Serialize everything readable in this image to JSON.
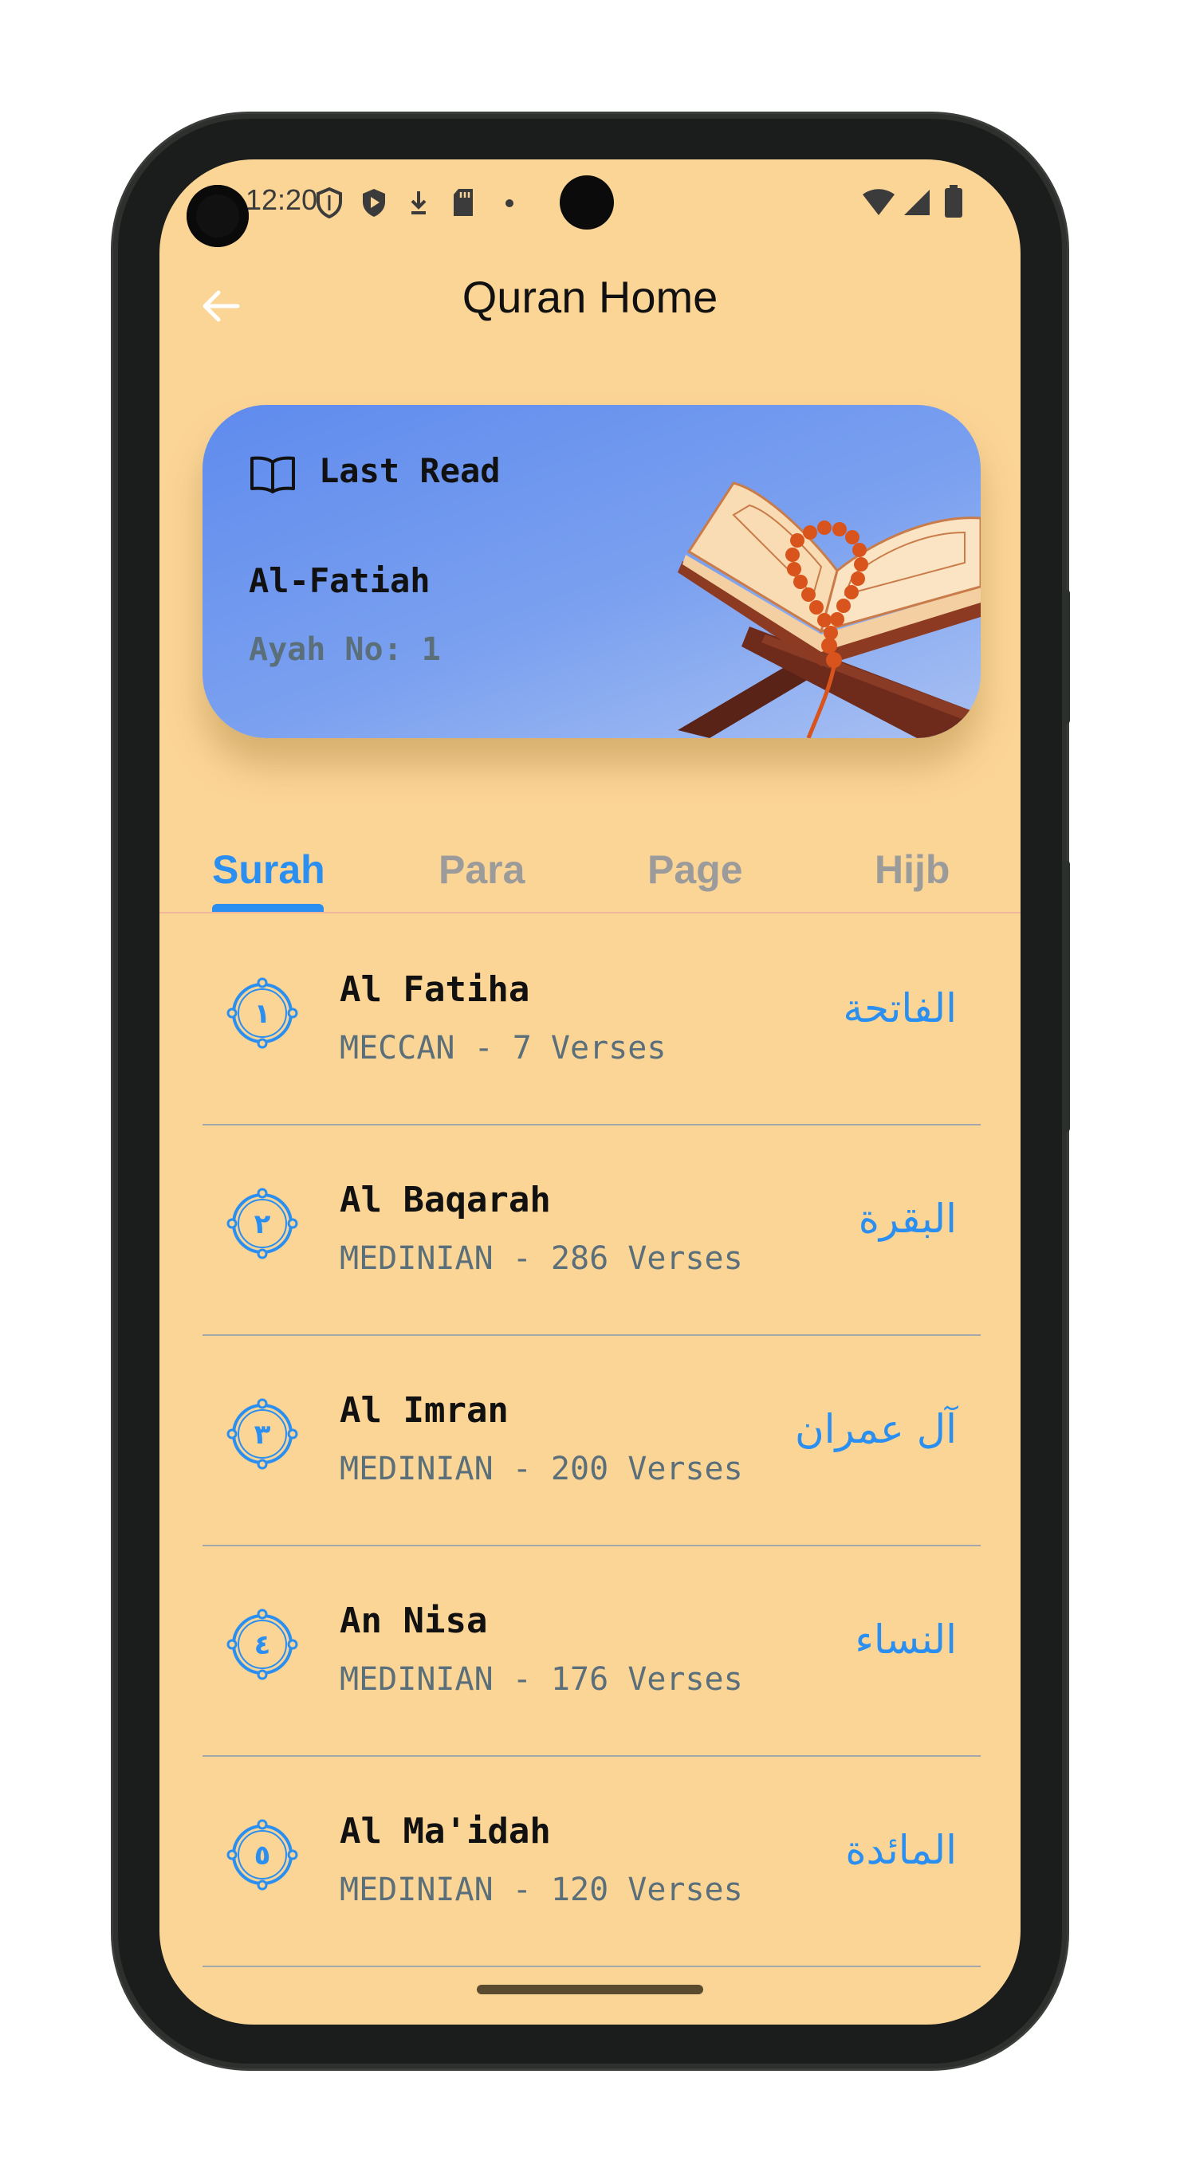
{
  "status_bar": {
    "time": "12:20",
    "left_icons": [
      "shield-outline-icon",
      "shield-play-icon",
      "download-arrow-icon",
      "sd-card-icon",
      "dot-icon"
    ],
    "right_icons": [
      "wifi-icon",
      "signal-icon",
      "battery-icon"
    ]
  },
  "app_bar": {
    "back_icon": "arrow-left-icon",
    "title": "Quran Home"
  },
  "last_read": {
    "icon": "open-book-icon",
    "label": "Last Read",
    "surah": "Al-Fatiah",
    "ayah": "Ayah No: 1",
    "image": "quran-on-stand-with-prayer-beads"
  },
  "tabs": [
    {
      "label": "Surah",
      "active": true
    },
    {
      "label": "Para",
      "active": false
    },
    {
      "label": "Page",
      "active": false
    },
    {
      "label": "Hijb",
      "active": false
    }
  ],
  "surahs": [
    {
      "number": "١",
      "name": "Al Fatiha",
      "meta": "MECCAN - 7 Verses",
      "arabic": "الفاتحة"
    },
    {
      "number": "٢",
      "name": "Al Baqarah",
      "meta": "MEDINIAN - 286 Verses",
      "arabic": "البقرة"
    },
    {
      "number": "٣",
      "name": "Al Imran",
      "meta": "MEDINIAN - 200 Verses",
      "arabic": "آل عمران"
    },
    {
      "number": "٤",
      "name": "An Nisa",
      "meta": "MEDINIAN - 176 Verses",
      "arabic": "النساء"
    },
    {
      "number": "٥",
      "name": "Al Ma'idah",
      "meta": "MEDINIAN - 120 Verses",
      "arabic": "المائدة"
    }
  ],
  "colors": {
    "background": "#fbd596",
    "accent": "#2a8ff0",
    "card_gradient_start": "#5f8bee",
    "card_gradient_end": "#a9c1f3",
    "secondary_text": "#5b6f7a"
  }
}
